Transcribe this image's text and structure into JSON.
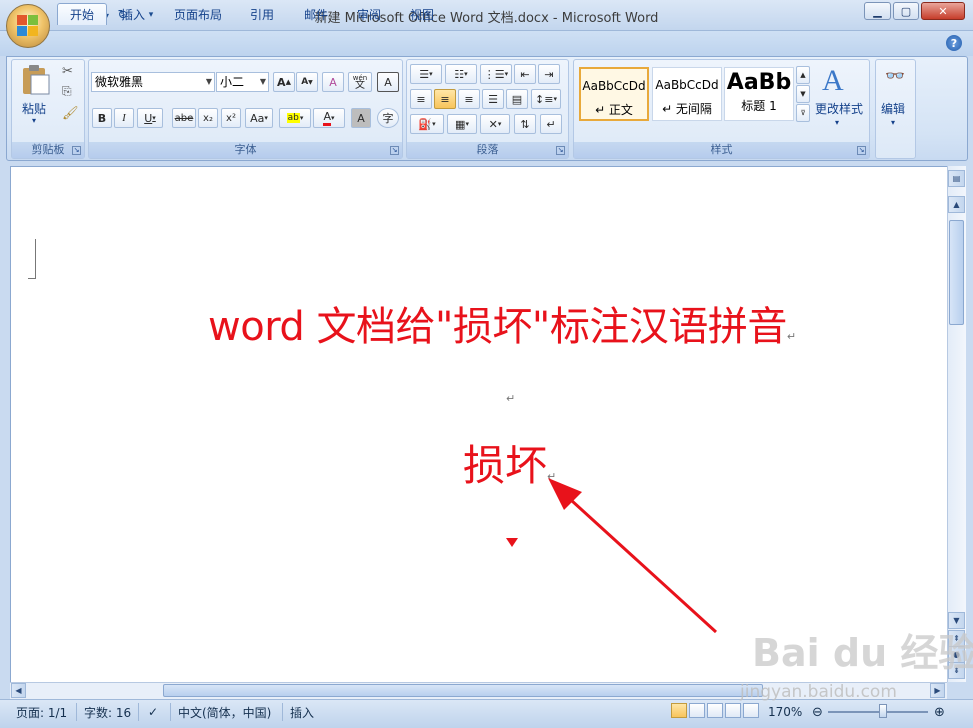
{
  "window": {
    "title": "新建 Microsoft Office Word 文档.docx - Microsoft Word",
    "minimize": "▁",
    "maximize": "▢",
    "close": "✕"
  },
  "tabs": [
    "开始",
    "插入",
    "页面布局",
    "引用",
    "邮件",
    "审阅",
    "视图"
  ],
  "ribbon": {
    "clipboard": {
      "label": "剪贴板",
      "paste_label": "粘贴"
    },
    "font": {
      "label": "字体",
      "font_name": "微软雅黑",
      "font_size": "小二",
      "bold": "B",
      "italic": "I",
      "underline": "U",
      "strike": "abe",
      "subscript": "x₂",
      "superscript": "x²",
      "change_case": "Aa",
      "grow": "A",
      "shrink": "A",
      "clear": "A",
      "phonetic_top": "wén",
      "phonetic_bottom": "文",
      "border_char": "A",
      "shade_char": "A",
      "enclose": "字"
    },
    "paragraph": {
      "label": "段落"
    },
    "styles": {
      "label": "样式",
      "items": [
        {
          "sample": "AaBbCcDd",
          "name": "↵ 正文"
        },
        {
          "sample": "AaBbCcDd",
          "name": "↵ 无间隔"
        },
        {
          "sample": "AaBb",
          "name": "标题 1"
        }
      ],
      "change_styles": "更改样式"
    },
    "editing": {
      "label": "编辑"
    }
  },
  "document": {
    "heading": "word 文档给\"损坏\"标注汉语拼音",
    "word": "损坏",
    "para_mark": "↵"
  },
  "statusbar": {
    "page": "页面: 1/1",
    "words": "字数: 16",
    "language": "中文(简体，中国)",
    "mode": "插入",
    "zoom": "170%"
  },
  "watermark": {
    "logo": "Bai du 经验",
    "url": "jingyan.baidu.com"
  },
  "colors": {
    "document_text": "#e8121b",
    "arrow": "#e8121b",
    "accent": "#15428b"
  }
}
